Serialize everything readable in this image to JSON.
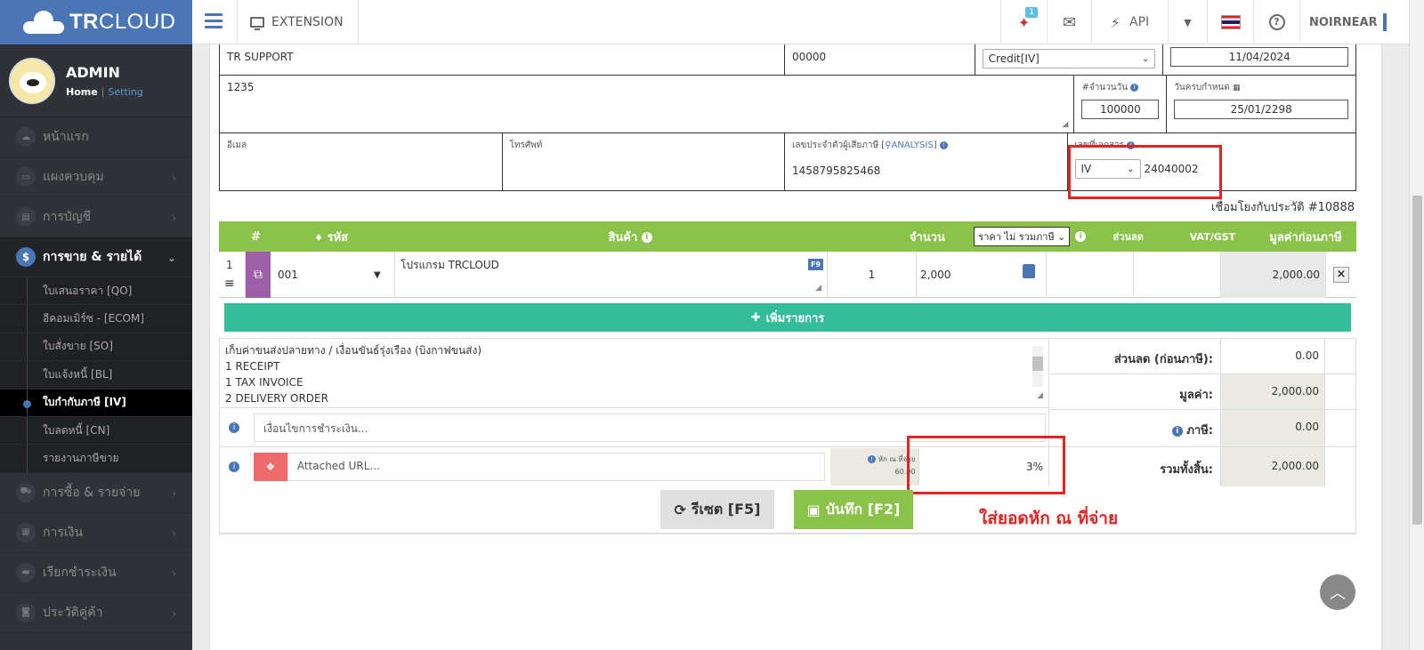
{
  "header": {
    "logo_text_bold": "TR",
    "logo_text": "CLOUD",
    "extension_label": "EXTENSION",
    "notification_count": "1",
    "api_label": "API",
    "user_name": "NOIRNEAR"
  },
  "sidebar": {
    "profile_name": "ADMIN",
    "home_label": "Home",
    "separator": "|",
    "setting_label": "Setting",
    "menu": [
      {
        "label": "หน้าแรก",
        "icon": "cloud-icon"
      },
      {
        "label": "แผงควบคุม",
        "icon": "monitor-icon"
      },
      {
        "label": "การบัญชี",
        "icon": "book-icon"
      },
      {
        "label": "การขาย & รายได้",
        "icon": "dollar-icon"
      },
      {
        "label": "การซื้อ & รายจ่าย",
        "icon": "cart-icon"
      },
      {
        "label": "การเงิน",
        "icon": "calendar-icon"
      },
      {
        "label": "เรียกชำระเงิน",
        "icon": "card-icon"
      },
      {
        "label": "ประวัติคู่ค้า",
        "icon": "contact-icon"
      }
    ],
    "submenu": [
      "ใบเสนอราคา [QO]",
      "อีคอมเมิร์ซ - [ECOM]",
      "ใบสั่งขาย [SO]",
      "ใบแจ้งหนี้ [BL]",
      "ใบกำกับภาษี [IV]",
      "ใบลดหนี้ [CN]",
      "รายงานภาษีขาย"
    ]
  },
  "form": {
    "customer_name": "TR SUPPORT",
    "branch_code": "00000",
    "doc_type": "Credit[IV]",
    "doc_date": "11/04/2024",
    "address": "1235",
    "days_label": "#จำนวนวัน",
    "days_value": "100000",
    "due_label": "วันครบกำหนด",
    "due_date": "25/01/2298",
    "email_label": "อีเมล",
    "phone_label": "โทรศัพท์",
    "tax_id_label": "เลขประจำตัวผู้เสียภาษี [",
    "analysis_label": "ANALYSIS",
    "tax_id_label_end": "]",
    "tax_id": "1458795825468",
    "doc_no_label": "เลขที่เอกสาร",
    "doc_prefix": "IV",
    "doc_number": "24040002"
  },
  "history_link": "เชื่อมโยงกับประวัติ #10888",
  "table": {
    "headers": {
      "num": "#",
      "code": "รหัส",
      "product": "สินค้า",
      "qty": "จำนวน",
      "price_mode": "ราคา ไม่ รวมภาษี",
      "discount": "ส่วนลด",
      "vat": "VAT/GST",
      "amount": "มูลค่าก่อนภาษี"
    },
    "rows": [
      {
        "num": "1",
        "code": "001",
        "product": "โปรแกรม TRCLOUD",
        "qty": "1",
        "price": "2,000",
        "amount": "2,000.00"
      }
    ],
    "f9": "F9",
    "remove": "×",
    "add_row": "เพิ่มรายการ"
  },
  "notes": {
    "lines": [
      "เก็บค่าขนส่งปลายทาง / เงื่อนขันธ์รุ่งเรือง (บิงกาฟขนส่ง)",
      "1 RECEIPT",
      "1 TAX INVOICE",
      "2 DELIVERY ORDER"
    ],
    "payment_placeholder": "เงื่อนไขการชำระเงิน...",
    "attached_placeholder": "Attached URL...",
    "wht_label": "หัก ณ ที่จ่าย",
    "wht_amount": "60.00",
    "wht_percent": "3%"
  },
  "summary": {
    "discount_label": "ส่วนลด (ก่อนภาษี):",
    "discount_value": "0.00",
    "value_label": "มูลค่า:",
    "value_value": "2,000.00",
    "tax_label": "ภาษี:",
    "tax_value": "0.00",
    "total_label": "รวมทั้งสิ้น:",
    "total_value": "2,000.00"
  },
  "buttons": {
    "reset": "รีเซต [F5]",
    "save": "บันทึก [F2]"
  },
  "annotation": "ใส่ยอดหัก ณ ที่จ่าย",
  "colors": {
    "brand_blue": "#4a76b8",
    "header_green": "#8bc34a",
    "add_green": "#35bd9a",
    "annotation_red": "#e52222"
  }
}
